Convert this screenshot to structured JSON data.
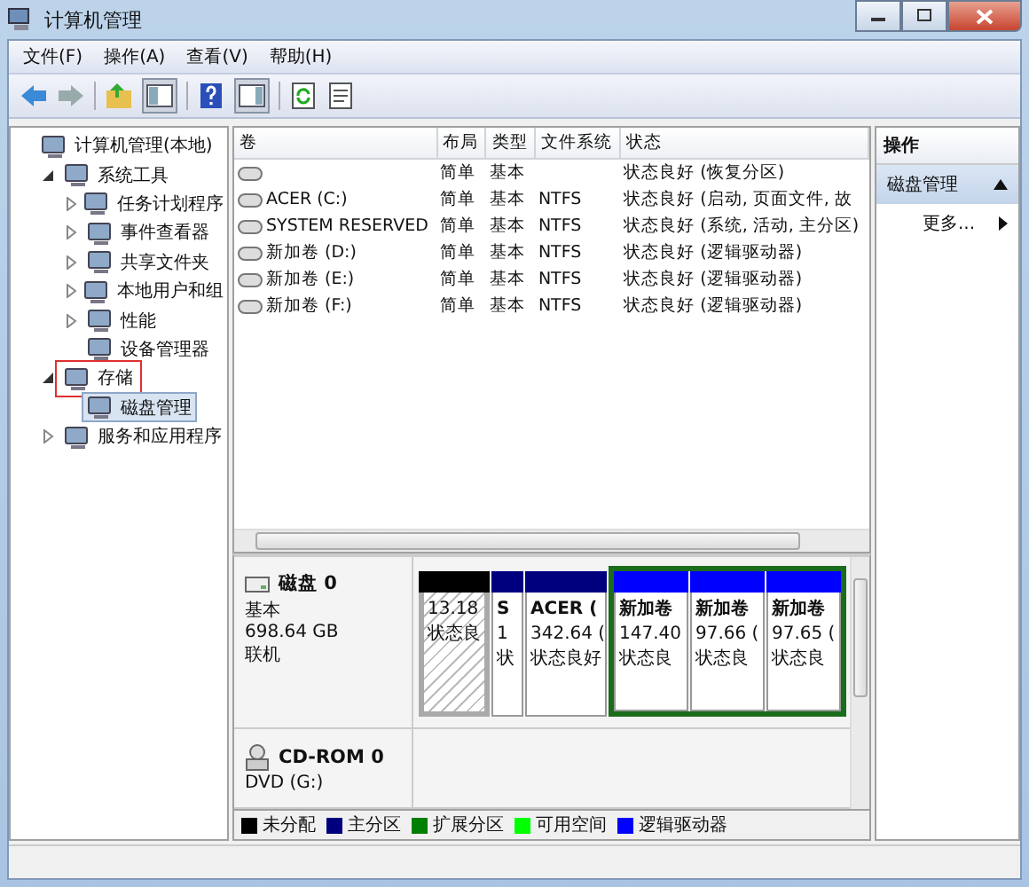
{
  "window": {
    "title": "计算机管理"
  },
  "menu": [
    "文件(F)",
    "操作(A)",
    "查看(V)",
    "帮助(H)"
  ],
  "tree": [
    {
      "label": "计算机管理(本地)",
      "selected": false,
      "highlighted": false,
      "children": [
        {
          "label": "系统工具",
          "expanded": true,
          "selected": false,
          "highlighted": false,
          "children": [
            {
              "label": "任务计划程序",
              "expanded": false,
              "selected": false,
              "highlighted": false
            },
            {
              "label": "事件查看器",
              "expanded": false,
              "selected": false,
              "highlighted": false
            },
            {
              "label": "共享文件夹",
              "expanded": false,
              "selected": false,
              "highlighted": false
            },
            {
              "label": "本地用户和组",
              "expanded": false,
              "selected": false,
              "highlighted": false
            },
            {
              "label": "性能",
              "expanded": false,
              "selected": false,
              "highlighted": false
            },
            {
              "label": "设备管理器",
              "selected": false,
              "highlighted": false
            }
          ]
        },
        {
          "label": "存储",
          "expanded": true,
          "selected": false,
          "highlighted": true,
          "children": [
            {
              "label": "磁盘管理",
              "selected": true,
              "highlighted": false
            }
          ]
        },
        {
          "label": "服务和应用程序",
          "expanded": false,
          "selected": false,
          "highlighted": false
        }
      ]
    }
  ],
  "table": {
    "columns": [
      "卷",
      "布局",
      "类型",
      "文件系统",
      "状态"
    ],
    "rows": [
      {
        "layout": "简单",
        "type": "基本",
        "status": "状态良好 (恢复分区)"
      },
      {
        "volume": "ACER (C:)",
        "layout": "简单",
        "type": "基本",
        "fs": "NTFS",
        "status": "状态良好 (启动, 页面文件, 故"
      },
      {
        "volume": "SYSTEM RESERVED",
        "layout": "简单",
        "type": "基本",
        "fs": "NTFS",
        "status": "状态良好 (系统, 活动, 主分区)"
      },
      {
        "volume": "新加卷 (D:)",
        "layout": "简单",
        "type": "基本",
        "fs": "NTFS",
        "status": "状态良好 (逻辑驱动器)"
      },
      {
        "volume": "新加卷 (E:)",
        "layout": "简单",
        "type": "基本",
        "fs": "NTFS",
        "status": "状态良好 (逻辑驱动器)"
      },
      {
        "volume": "新加卷 (F:)",
        "layout": "简单",
        "type": "基本",
        "fs": "NTFS",
        "status": "状态良好 (逻辑驱动器)"
      }
    ]
  },
  "disks": [
    {
      "kind": "disk",
      "name": "磁盘 0",
      "lines": [
        "基本",
        "698.64 GB",
        "联机"
      ],
      "partitions": [
        {
          "kind": "unallocated",
          "lines": [
            "13.18",
            "状态良"
          ]
        },
        {
          "kind": "primary",
          "lines": [
            "S",
            "1",
            "状"
          ]
        },
        {
          "kind": "primary",
          "lines": [
            "ACER (",
            "342.64 (",
            "状态良好"
          ]
        },
        {
          "kind": "extended",
          "children": [
            {
              "kind": "logical",
              "lines": [
                "新加卷",
                "147.40",
                "状态良"
              ]
            },
            {
              "kind": "logical",
              "lines": [
                "新加卷",
                "97.66 (",
                "状态良"
              ]
            },
            {
              "kind": "logical",
              "lines": [
                "新加卷",
                "97.65 (",
                "状态良"
              ]
            }
          ]
        }
      ]
    },
    {
      "kind": "cdrom",
      "name": "CD-ROM 0",
      "lines": [
        "DVD (G:)"
      ]
    }
  ],
  "legend": [
    {
      "label": "未分配",
      "color": "#000000"
    },
    {
      "label": "主分区",
      "color": "#00007f"
    },
    {
      "label": "扩展分区",
      "color": "#008000"
    },
    {
      "label": "可用空间",
      "color": "#00ff00"
    },
    {
      "label": "逻辑驱动器",
      "color": "#0000ff"
    }
  ],
  "actions": {
    "header": "操作",
    "section": "磁盘管理",
    "expanded": true,
    "items": [
      "更多..."
    ]
  }
}
